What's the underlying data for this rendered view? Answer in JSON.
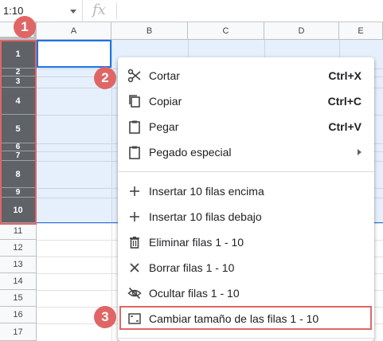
{
  "formula_bar": {
    "name_box": "1:10",
    "fx": "fx"
  },
  "columns": [
    "A",
    "B",
    "C",
    "D",
    "E"
  ],
  "rows": [
    "1",
    "2",
    "3",
    "4",
    "5",
    "6",
    "7",
    "8",
    "9",
    "10",
    "11",
    "12",
    "13",
    "14",
    "15",
    "16",
    "17"
  ],
  "context_menu": {
    "items": [
      {
        "label": "Cortar",
        "shortcut": "Ctrl+X",
        "icon": "scissors-icon"
      },
      {
        "label": "Copiar",
        "shortcut": "Ctrl+C",
        "icon": "copy-icon"
      },
      {
        "label": "Pegar",
        "shortcut": "Ctrl+V",
        "icon": "clipboard-icon"
      },
      {
        "label": "Pegado especial",
        "shortcut": "",
        "icon": "clipboard-icon",
        "submenu": true
      },
      {
        "label": "Insertar 10 filas encima",
        "shortcut": "",
        "icon": "plus-icon"
      },
      {
        "label": "Insertar 10 filas debajo",
        "shortcut": "",
        "icon": "plus-icon"
      },
      {
        "label": "Eliminar filas 1 - 10",
        "shortcut": "",
        "icon": "trash-icon"
      },
      {
        "label": "Borrar filas 1 - 10",
        "shortcut": "",
        "icon": "x-icon"
      },
      {
        "label": "Ocultar filas 1 - 10",
        "shortcut": "",
        "icon": "eye-off-icon"
      },
      {
        "label": "Cambiar tamaño de las filas 1 - 10",
        "shortcut": "",
        "icon": "resize-icon"
      }
    ]
  },
  "callouts": [
    "1",
    "2",
    "3"
  ],
  "colors": {
    "accent": "#1a73e8",
    "callout": "#e06666",
    "selected_header": "#5f6368"
  }
}
